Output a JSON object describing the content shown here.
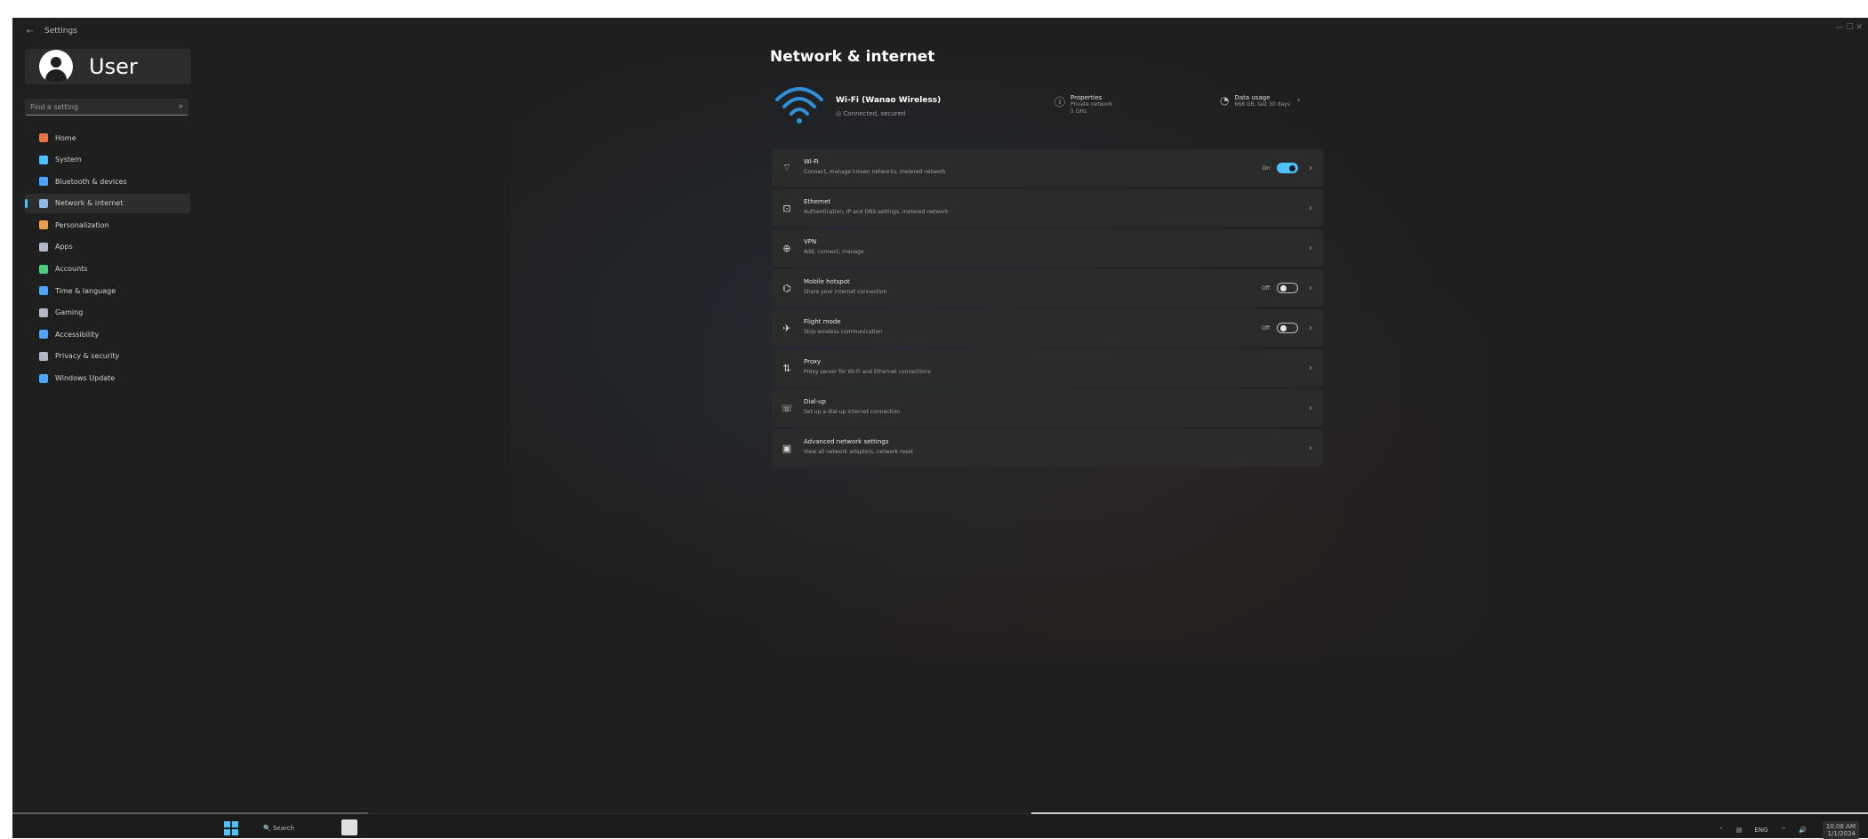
{
  "window": {
    "title": "Settings",
    "back_glyph": "←",
    "controls": "—   ☐   ✕"
  },
  "user": {
    "name": "User"
  },
  "search": {
    "placeholder": "Find a setting",
    "icon": "search-icon"
  },
  "nav": {
    "items": [
      {
        "label": "Home",
        "color": "#e8734a"
      },
      {
        "label": "System",
        "color": "#4cc2ff"
      },
      {
        "label": "Bluetooth & devices",
        "color": "#4ca6ff"
      },
      {
        "label": "Network & internet",
        "color": "#8fb8e8"
      },
      {
        "label": "Personalization",
        "color": "#e8a04a"
      },
      {
        "label": "Apps",
        "color": "#b0b8c8"
      },
      {
        "label": "Accounts",
        "color": "#4ccf7f"
      },
      {
        "label": "Time & language",
        "color": "#4ca6ff"
      },
      {
        "label": "Gaming",
        "color": "#b0b8c8"
      },
      {
        "label": "Accessibility",
        "color": "#4ca6ff"
      },
      {
        "label": "Privacy & security",
        "color": "#b0b8c8"
      },
      {
        "label": "Windows Update",
        "color": "#4ca6ff"
      }
    ],
    "selected_index": 3
  },
  "content": {
    "title": "Network & internet",
    "hero": {
      "network_name": "Wi-Fi (Wanao Wireless)",
      "network_status": "◎ Connected, secured",
      "properties_title": "Properties",
      "properties_sub1": "Private network",
      "properties_sub2": "5 GHz",
      "usage_title": "Data usage",
      "usage_sub": "668 GB, last 30 days"
    },
    "rows": [
      {
        "icon": "wifi-icon",
        "glyph": "⌔",
        "title": "Wi-Fi",
        "sub": "Connect, manage known networks, metered network",
        "toggle": "On"
      },
      {
        "icon": "ethernet-icon",
        "glyph": "⊡",
        "title": "Ethernet",
        "sub": "Authentication, IP and DNS settings, metered network",
        "toggle": ""
      },
      {
        "icon": "vpn-icon",
        "glyph": "⊕",
        "title": "VPN",
        "sub": "Add, connect, manage",
        "toggle": ""
      },
      {
        "icon": "mobile-hotspot-icon",
        "glyph": "⌬",
        "title": "Mobile hotspot",
        "sub": "Share your internet connection",
        "toggle": "Off"
      },
      {
        "icon": "airplane-icon",
        "glyph": "✈",
        "title": "Flight mode",
        "sub": "Stop wireless communication",
        "toggle": "Off"
      },
      {
        "icon": "proxy-icon",
        "glyph": "⇅",
        "title": "Proxy",
        "sub": "Proxy server for Wi-Fi and Ethernet connections",
        "toggle": ""
      },
      {
        "icon": "dialup-icon",
        "glyph": "☏",
        "title": "Dial-up",
        "sub": "Set up a dial-up internet connection",
        "toggle": ""
      },
      {
        "icon": "advanced-network-icon",
        "glyph": "▣",
        "title": "Advanced network settings",
        "sub": "View all network adapters, network reset",
        "toggle": ""
      }
    ],
    "chevron": "›"
  },
  "taskbar": {
    "search_label": "🔍 Search",
    "tray": [
      "⌃",
      "▤",
      "ENG",
      "⌔",
      "🔊"
    ],
    "clock_time": "10:08 AM",
    "clock_date": "1/1/2024"
  },
  "colors": {
    "accent": "#4cc2ff",
    "window_bg": "#1f1f1f",
    "card_bg": "#2b2b2b"
  }
}
